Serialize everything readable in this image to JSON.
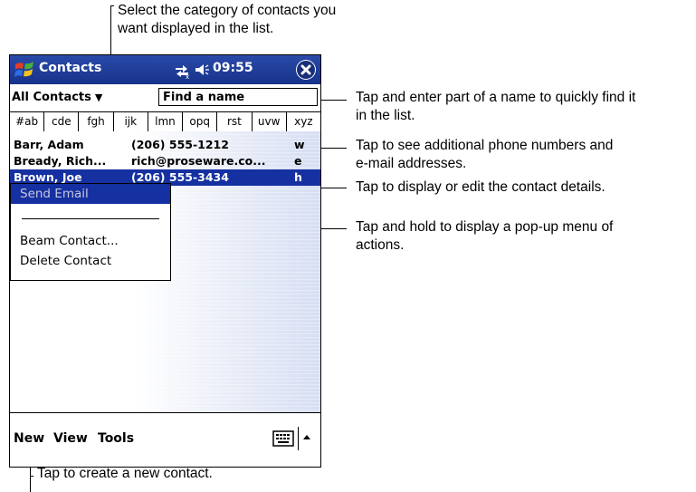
{
  "annotations": {
    "category_note": [
      "Select the category of contacts you",
      "want displayed in the list."
    ],
    "find_note": [
      "Tap and enter part of a name to quickly find it",
      "in the list."
    ],
    "phone_note": [
      "Tap to see additional phone numbers and",
      "e-mail addresses."
    ],
    "details_note": "Tap to display or edit the contact details.",
    "popup_note": [
      "Tap and hold to display a pop-up menu of",
      "actions."
    ],
    "new_note": "Tap to create a new contact."
  },
  "titlebar": {
    "app_title": "Contacts",
    "clock": "09:55"
  },
  "filter": {
    "category": "All Contacts",
    "find_value": "Find a name"
  },
  "letter_tabs": [
    "#ab",
    "cde",
    "fgh",
    "ijk",
    "lmn",
    "opq",
    "rst",
    "uvw",
    "xyz"
  ],
  "contacts": [
    {
      "name": "Barr, Adam",
      "info": "(206) 555-1212",
      "type": "w"
    },
    {
      "name": "Bready, Rich...",
      "info": "rich@proseware.co...",
      "type": "e"
    },
    {
      "name": "Brown, Joe",
      "info": "(206) 555-3434",
      "type": "h"
    }
  ],
  "popup_menu": {
    "send_email": "Send Email",
    "beam_contact": "Beam Contact...",
    "delete_contact": "Delete Contact"
  },
  "menubar": {
    "new": "New",
    "view": "View",
    "tools": "Tools"
  },
  "colors": {
    "titlebar": "#1e3c9a",
    "selection": "#1530a0",
    "disabled_text": "#8a8aa0"
  },
  "icons": [
    "windows-start-icon",
    "connectivity-icon",
    "speaker-icon",
    "close-icon",
    "keyboard-icon",
    "sip-arrow-icon"
  ]
}
